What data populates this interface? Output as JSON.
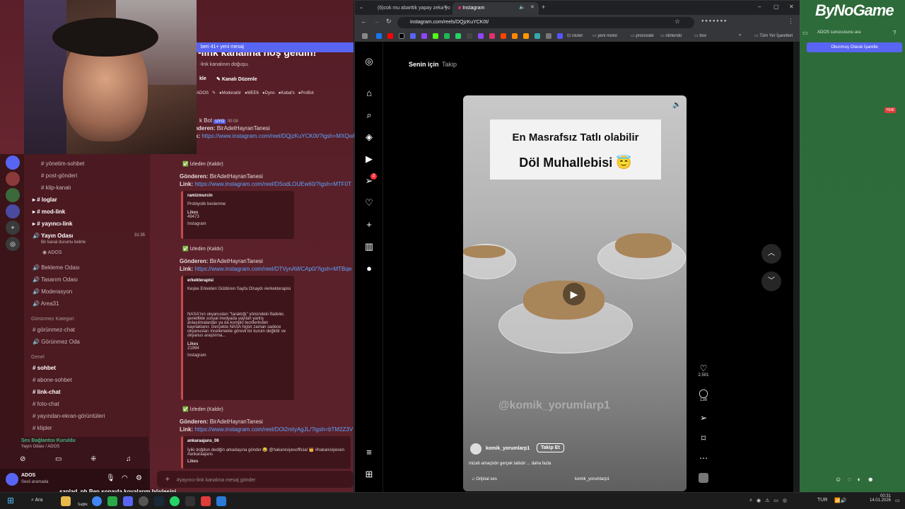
{
  "browser": {
    "tabs": [
      {
        "label": "(6)cok mu abarttik yapay zeka yo"
      },
      {
        "label": "Instagram"
      }
    ],
    "url": "instagram.com/reels/DQjzKuYCK0t/",
    "bookmarks": [
      "router",
      "yeni motor",
      "procreate",
      "nintendo",
      "box",
      "Tüm Yer İşaretleri"
    ]
  },
  "instagram": {
    "feed_tabs": [
      "Senin için",
      "Takip"
    ],
    "caption_line1": "En Masrafsız Tatlı olabilir",
    "caption_line2": "Döl Muhallebisi 😇",
    "watermark": "@komik_yorumlarp1",
    "username": "komik_yorumlarp1",
    "follow": "Takip Et",
    "description": "mizah amaçlıdır gerçek tatlıdır ... daha fazla",
    "audio": "Orijinal ses",
    "audio_user": "komik_yorumlarp1",
    "likes": "2.501",
    "comments": "138",
    "notification_badge": "2"
  },
  "discord": {
    "banner": "beri 41+ yeni mesaj",
    "channel_title": "-link kanalına hoş geldin!",
    "channel_sub": "-link kanalının doğuşu.",
    "edit_channel": "Kanalı Düzenle",
    "edit_prefix": "kle",
    "roles": [
      "ADOS",
      "Moderatör",
      "MEE6",
      "Dyno",
      "Kabal's",
      "ProBot"
    ],
    "channels": [
      {
        "name": "yönetim-sohbet"
      },
      {
        "name": "post-gönderi"
      },
      {
        "name": "klip-kanalı"
      },
      {
        "name": "loglar",
        "bold": true
      },
      {
        "name": "mod-link",
        "bold": true
      },
      {
        "name": "yayıncı-link",
        "bold": true
      },
      {
        "name": "Yayın Odası",
        "bold": true
      },
      {
        "name": "Bir kanal durumu belirle"
      },
      {
        "name": "ADOS"
      },
      {
        "name": "Bekleme Odası"
      },
      {
        "name": "Tasarım Odası"
      },
      {
        "name": "Moderasyon"
      },
      {
        "name": "Area31"
      },
      {
        "name": "Görünmez Kategori"
      },
      {
        "name": "görünmez-chat"
      },
      {
        "name": "Görünmez Oda"
      },
      {
        "name": "Genel"
      },
      {
        "name": "sohbet",
        "bold": true
      },
      {
        "name": "abone-sohbet"
      },
      {
        "name": "link-chat",
        "bold": true
      },
      {
        "name": "foto-chat"
      },
      {
        "name": "yayından-ekran-görüntüleri"
      },
      {
        "name": "klipler"
      }
    ],
    "timer": "31:35",
    "voice_status": "Ses Bağlantısı Kuruldu",
    "voice_sub": "Yayın Odası / ADOS",
    "user": "ADOS",
    "user_status": "Sesli aramada",
    "input_placeholder": "#yayıncı-link kanalına mesaj gönder",
    "messages": [
      {
        "bot": "k Bot",
        "tag": "UYG",
        "time": "00:08",
        "sender_label": "Gönderen:",
        "sender": "BirAdetHayranTanesi",
        "link_label": "Link:",
        "link": "https://www.instagram.com/reel/DQjzKuYCK0t/?igsh=MXQwNr"
      },
      {
        "sender_label": "Gönderen:",
        "sender": "BirAdetHayranTanesi",
        "link_label": "Link:",
        "link": "https://www.instagram.com/reel/DSodLOUEw60/?igsh=MTF0T"
      },
      {
        "sender_label": "Gönderen:",
        "sender": "BirAdetHayranTanesi",
        "link_label": "Link:",
        "link": "https://www.instagram.com/reel/DTVynAWCAp0/?igsh=MTBqe"
      },
      {
        "sender_label": "Gönderen:",
        "sender": "BirAdetHayranTanesi",
        "link_label": "Link:",
        "link": "https://www.instagram.com/reel/DOi2mIyAgJL/?igsh=bTM2Z3V"
      }
    ],
    "seen": "İzledim (Kaldır)",
    "embeds": [
      {
        "author": "ramizmurcin",
        "text": "Probiyotik beslenme",
        "likes_label": "Likes",
        "likes": "49473",
        "source": "Instagram"
      },
      {
        "author": "erkekterapisi",
        "text": "Keşke Erkekleri Güldüren Sayfa Olsaydı #erkekterapisi",
        "text2": "NASA'nın okyanusları \"taraktığı\" yönündeki ifadeler, genellikle sosyal medyada yayılan yanlış anlaşılmalardan ya da komplo teorilerinden kaynaklanır. Gerçekte NASA hiçbir zaman sadece okyanusları incelemekle görevli bir kurum değildir ve okyanus araştırma...",
        "likes_label": "Likes",
        "likes": "21994",
        "source": "Instagram"
      },
      {
        "author": "ankaraajans_06",
        "text": "İyiki doğdun dediğin arkadaşına gönder 😂 @hakanisiyesofficial 👑 #hakanisiyesen #ankaraajans",
        "likes_label": "Likes"
      }
    ]
  },
  "right_panel": {
    "logo": "ByNoGame",
    "search": "ADOS sunucusunu ara",
    "mark_read": "Okunmuş Olarak İşaretle",
    "new_badge": "YENİ"
  },
  "overlay_chat": {
    "user": "sanlad_ph",
    "text": "Ben sopayla kovalarım böylesini"
  },
  "taskbar": {
    "search": "Ara",
    "time": "00:31",
    "date": "14.01.2026",
    "lang": "TUR",
    "sub_label": "Sağlık"
  },
  "colors": {
    "discord_bg": "#6e2a33",
    "instagram_bg": "#000000",
    "right_panel": "#2f6c3c",
    "link": "#5ea4ff"
  }
}
